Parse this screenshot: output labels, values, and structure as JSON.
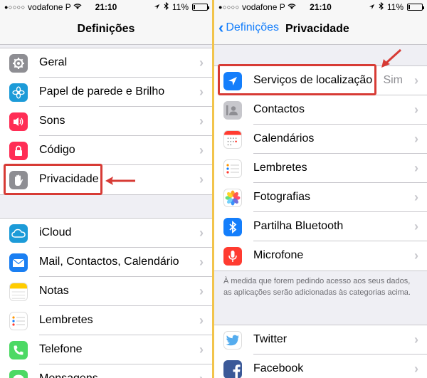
{
  "status_bar": {
    "carrier": "vodafone P",
    "time": "21:10",
    "battery": "11%",
    "battery_level": 0.11
  },
  "left": {
    "title": "Definições",
    "group1": [
      {
        "label": "Geral",
        "icon": "gear-icon",
        "color": "#8e8e93"
      },
      {
        "label": "Papel de parede e Brilho",
        "icon": "flower-icon",
        "color": "#1c9bd8"
      },
      {
        "label": "Sons",
        "icon": "speaker-icon",
        "color": "#ff2d55"
      },
      {
        "label": "Código",
        "icon": "lock-icon",
        "color": "#ff2d55"
      },
      {
        "label": "Privacidade",
        "icon": "hand-icon",
        "color": "#8e8e93"
      }
    ],
    "group2": [
      {
        "label": "iCloud",
        "icon": "cloud-icon",
        "color": "#1c9bd8"
      },
      {
        "label": "Mail, Contactos, Calendário",
        "icon": "envelope-icon",
        "color": "#1a7ff2"
      },
      {
        "label": "Notas",
        "icon": "notes-icon",
        "color": "#ffcc00"
      },
      {
        "label": "Lembretes",
        "icon": "list-icon",
        "color": "#ffffff"
      },
      {
        "label": "Telefone",
        "icon": "phone-icon",
        "color": "#4cd964"
      },
      {
        "label": "Mensagens",
        "icon": "message-icon",
        "color": "#4cd964"
      }
    ]
  },
  "right": {
    "back_label": "Definições",
    "title": "Privacidade",
    "group1": [
      {
        "label": "Serviços de localização",
        "detail": "Sim",
        "icon": "location-arrow-icon",
        "color": "#147efb"
      },
      {
        "label": "Contactos",
        "icon": "contacts-icon",
        "color": "#a5a5aa"
      },
      {
        "label": "Calendários",
        "icon": "calendar-icon",
        "color": "#ffffff"
      },
      {
        "label": "Lembretes",
        "icon": "list-icon",
        "color": "#ffffff"
      },
      {
        "label": "Fotografias",
        "icon": "photos-icon",
        "color": "#ffffff"
      },
      {
        "label": "Partilha Bluetooth",
        "icon": "bluetooth-icon",
        "color": "#147efb"
      },
      {
        "label": "Microfone",
        "icon": "microphone-icon",
        "color": "#ff3b30"
      }
    ],
    "footer": "À medida que forem pedindo acesso aos seus dados, as aplicações serão adicionadas às categorias acima.",
    "group2": [
      {
        "label": "Twitter",
        "icon": "twitter-icon",
        "color": "#ffffff"
      },
      {
        "label": "Facebook",
        "icon": "facebook-icon",
        "color": "#3b5998"
      }
    ]
  },
  "highlight_color": "#d73b35"
}
